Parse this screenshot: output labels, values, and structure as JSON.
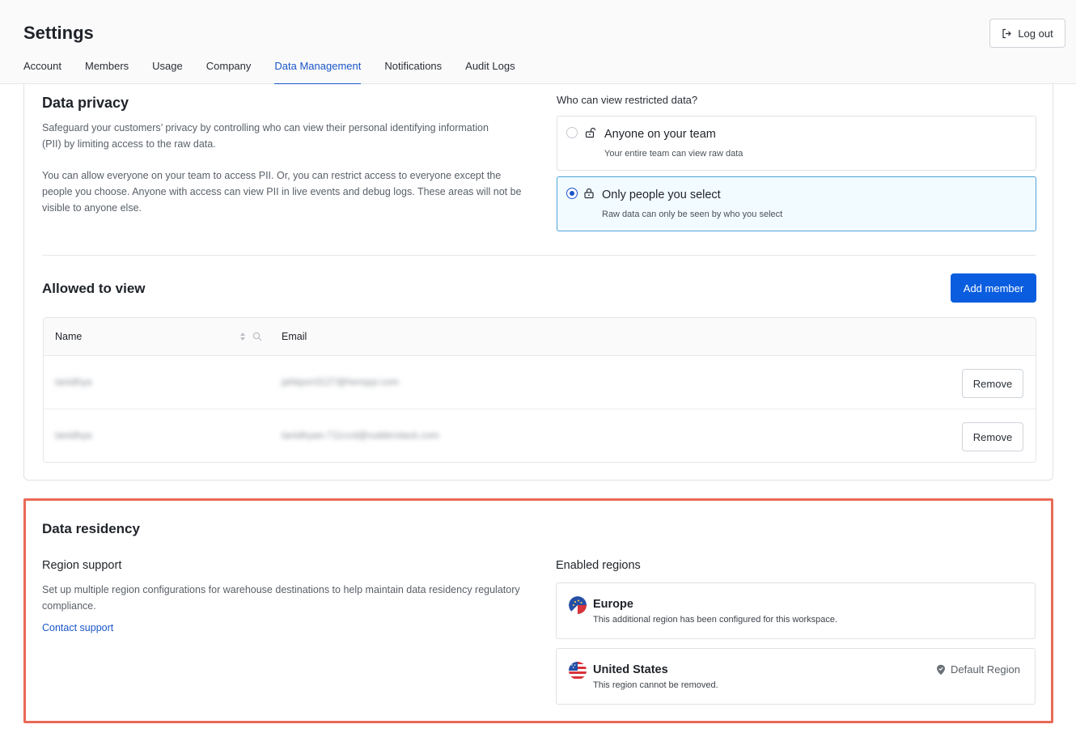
{
  "header": {
    "title": "Settings",
    "logout_label": "Log out",
    "tabs": [
      "Account",
      "Members",
      "Usage",
      "Company",
      "Data Management",
      "Notifications",
      "Audit Logs"
    ],
    "active_tab": "Data Management"
  },
  "privacy": {
    "title": "Data privacy",
    "para1": "Safeguard your customers’ privacy by controlling who can view their personal identifying information (PII) by limiting access to the raw data.",
    "para2": "You can allow everyone on your team to access PII. Or, you can restrict access to everyone except the people you choose. Anyone with access can view PII in live events and debug logs. These areas will not be visible to anyone else.",
    "question": "Who can view restricted data?",
    "options": [
      {
        "title": "Anyone on your team",
        "subtitle": "Your entire team can view raw data",
        "selected": false,
        "icon": "unlock-icon"
      },
      {
        "title": "Only people you select",
        "subtitle": "Raw data can only be seen by who you select",
        "selected": true,
        "icon": "lock-icon"
      }
    ]
  },
  "allowed": {
    "title": "Allowed to view",
    "add_label": "Add member",
    "columns": {
      "name": "Name",
      "email": "Email"
    },
    "rows": [
      {
        "name": "tanidhya",
        "email": "jahlqsm3127@hempyi.com",
        "action": "Remove"
      },
      {
        "name": "tanidhya",
        "email": "tanidhyan-711ccd@rudderstack.com",
        "action": "Remove"
      }
    ]
  },
  "residency": {
    "title": "Data residency",
    "region_support": "Region support",
    "desc": "Set up multiple region configurations for warehouse destinations to help maintain data residency regulatory compliance.",
    "contact_label": "Contact support",
    "enabled_title": "Enabled regions",
    "regions": [
      {
        "name": "Europe",
        "desc": "This additional region has been configured for this workspace.",
        "flag": "eu-flag-icon"
      },
      {
        "name": "United States",
        "desc": "This region cannot be removed.",
        "flag": "us-flag-icon",
        "tag": "Default Region"
      }
    ]
  },
  "colors": {
    "accent": "#1a55c9",
    "primary_button": "#0a5ddf",
    "highlight_border": "#e96a55",
    "selected_bg": "#f2fbff"
  }
}
